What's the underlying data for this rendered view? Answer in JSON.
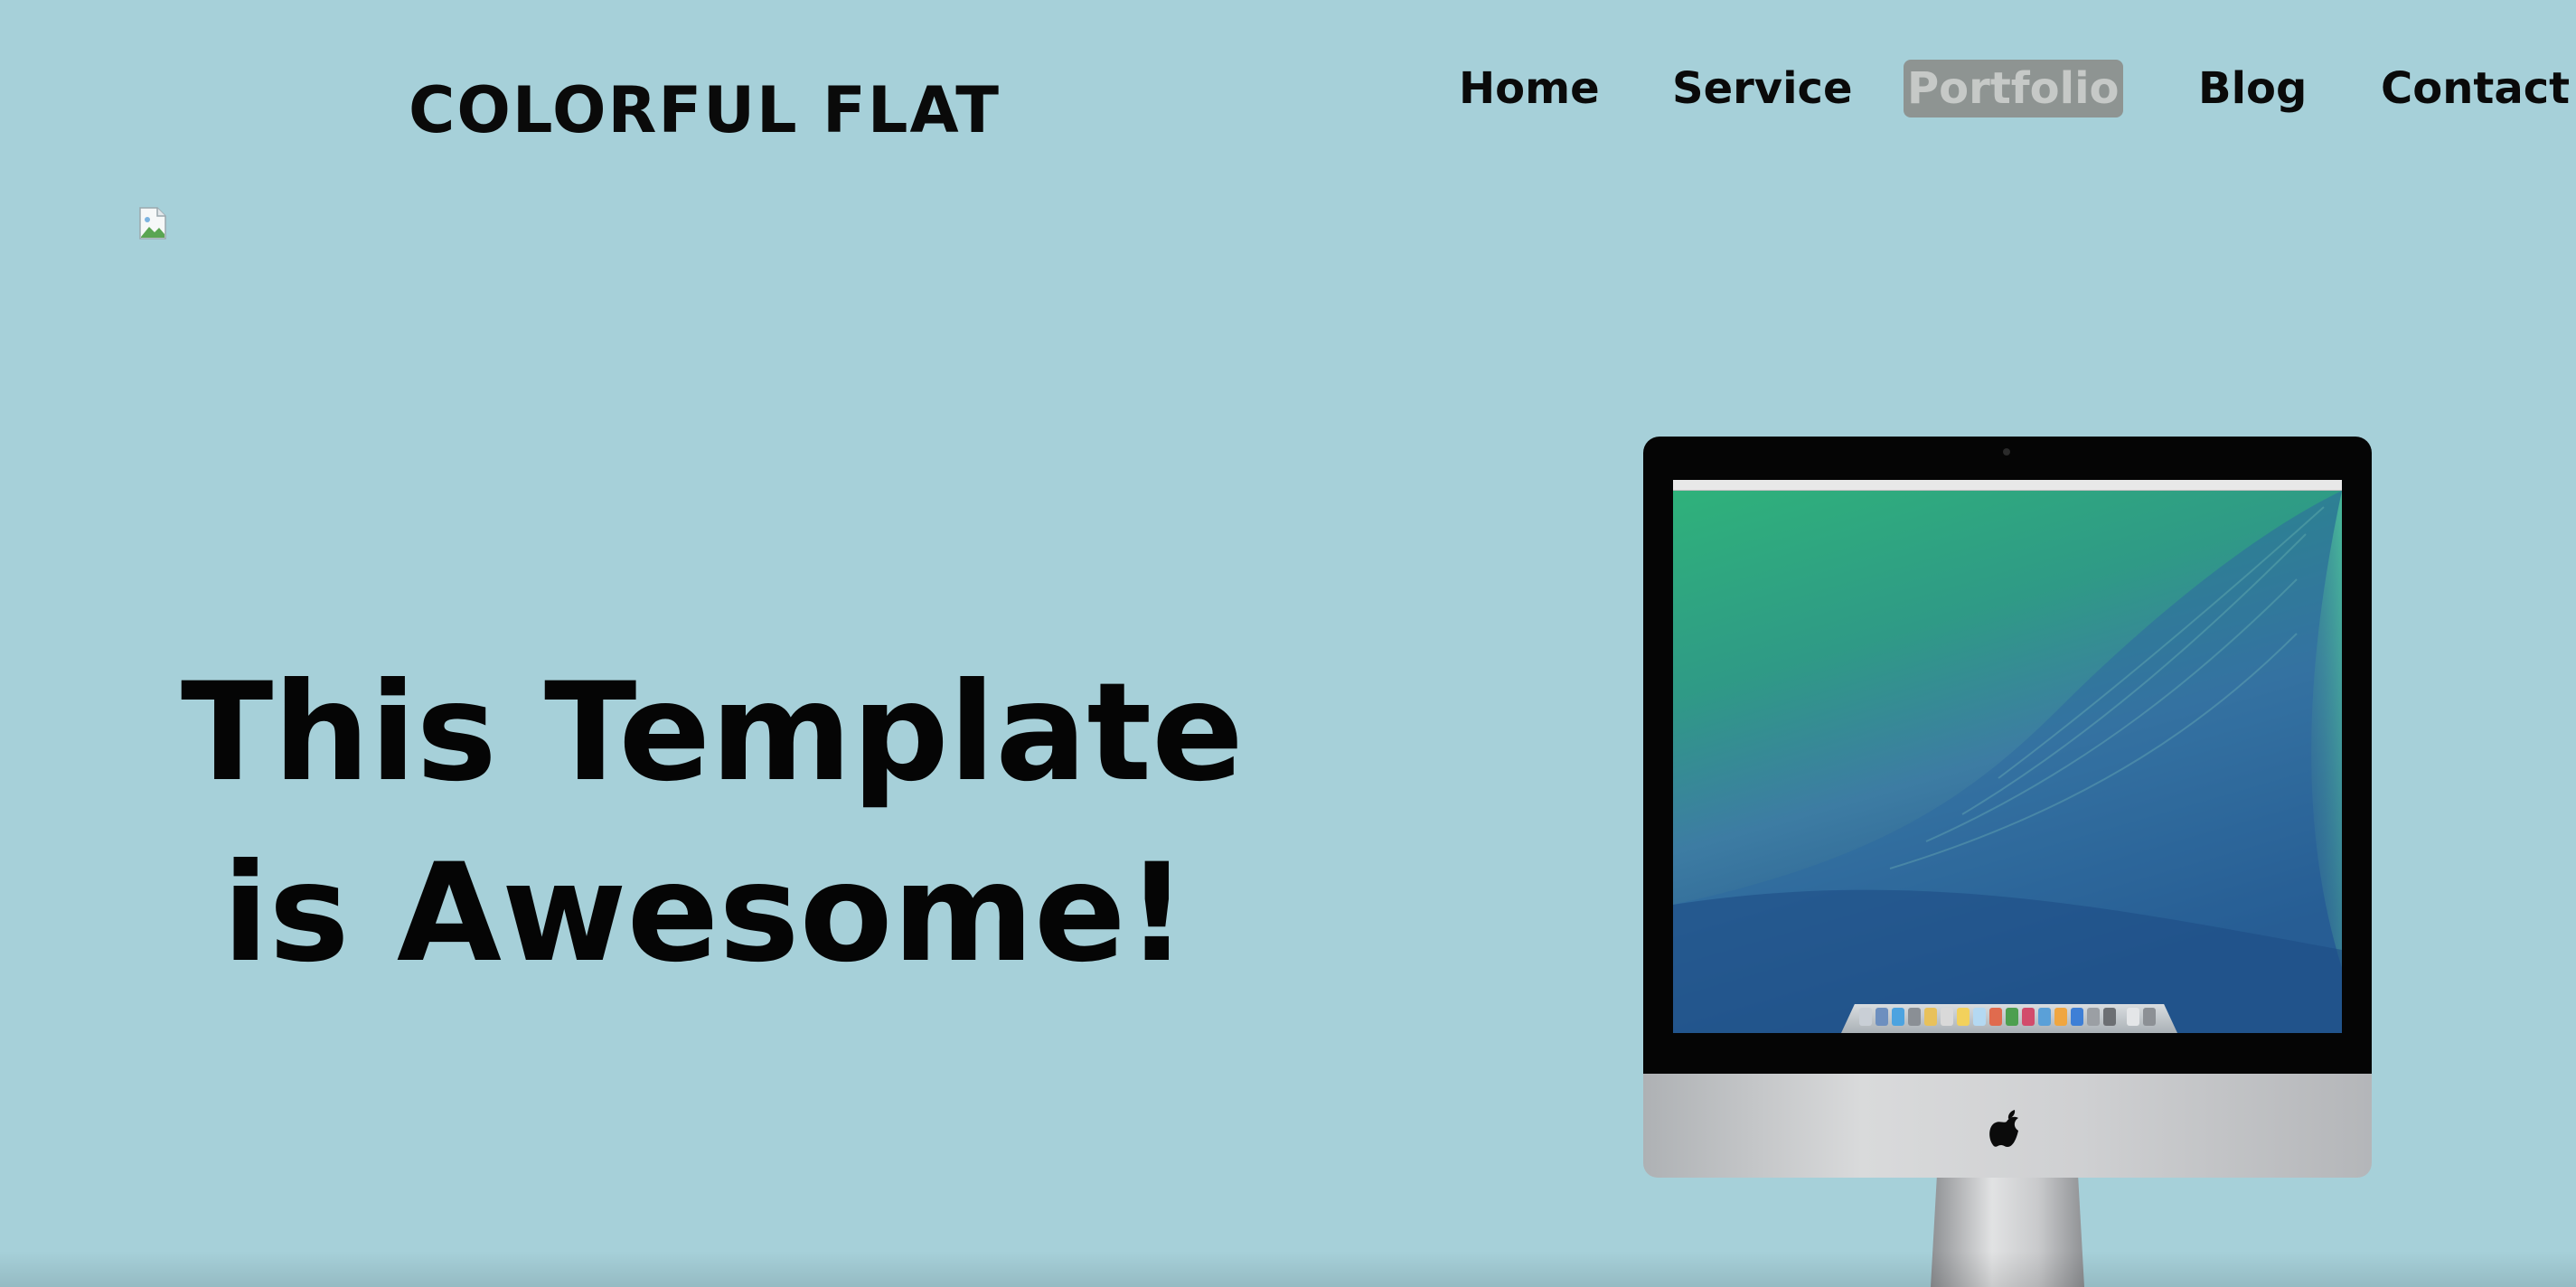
{
  "header": {
    "logo_text": "COLORFUL FLAT"
  },
  "nav": {
    "items": [
      {
        "label": "Home",
        "active": false
      },
      {
        "label": "Service",
        "active": false
      },
      {
        "label": "Portfolio",
        "active": true
      },
      {
        "label": "Blog",
        "active": false
      },
      {
        "label": "Contact",
        "active": false
      }
    ]
  },
  "hero": {
    "title_line1": "This Template",
    "title_line2": "is Awesome!"
  },
  "images": {
    "broken_image_icon": "broken-image-icon",
    "device": "imac-icon",
    "device_logo": "apple-logo-icon"
  },
  "colors": {
    "background": "#a6d0d9",
    "text": "#0a0a0a",
    "nav_active_bg": "#8e9492",
    "nav_active_text": "#c6c9c7"
  }
}
